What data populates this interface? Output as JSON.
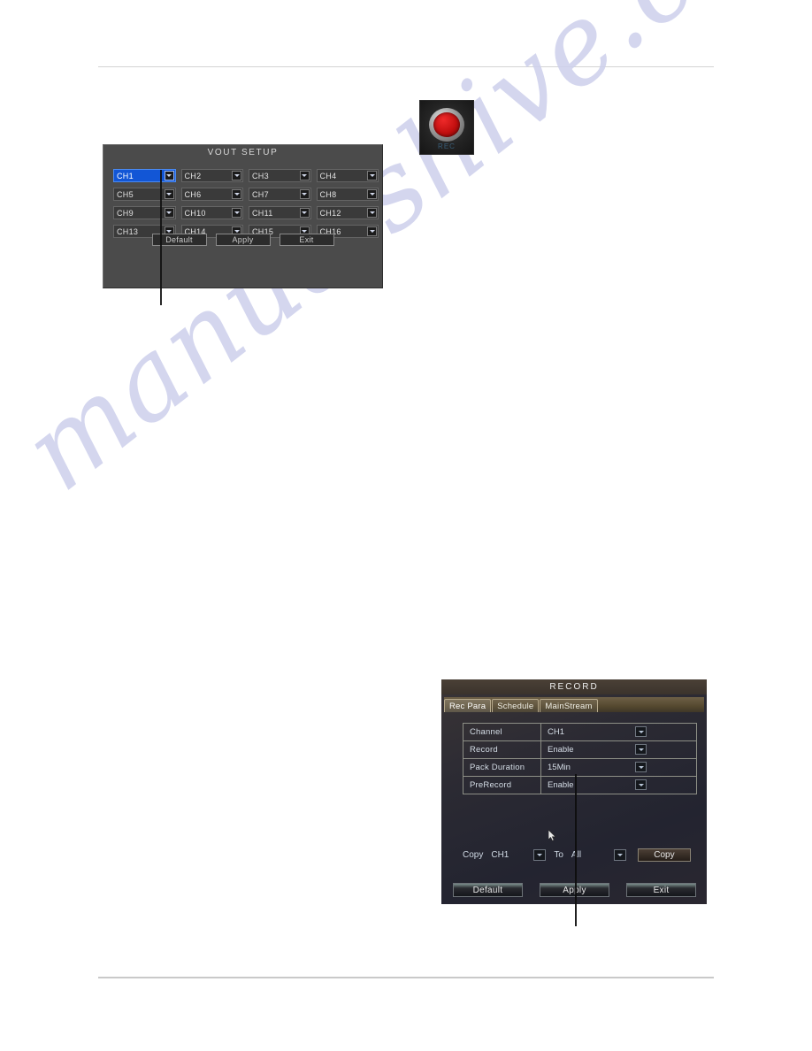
{
  "watermark": {
    "text": "manualshive.com"
  },
  "vout_dialog": {
    "title": "VOUT SETUP",
    "channels": [
      "CH1",
      "CH2",
      "CH3",
      "CH4",
      "CH5",
      "CH6",
      "CH7",
      "CH8",
      "CH9",
      "CH10",
      "CH11",
      "CH12",
      "CH13",
      "CH14",
      "CH15",
      "CH16"
    ],
    "selected_index": 0,
    "buttons": {
      "default": "Default",
      "apply": "Apply",
      "exit": "Exit"
    }
  },
  "record_icon": {
    "label": "REC",
    "button_color": "#c20f0f"
  },
  "record_dialog": {
    "title": "RECORD",
    "tabs": [
      {
        "label": "Rec Para",
        "active": true
      },
      {
        "label": "Schedule",
        "active": false
      },
      {
        "label": "MainStream",
        "active": false
      }
    ],
    "rows": [
      {
        "label": "Channel",
        "value": "CH1"
      },
      {
        "label": "Record",
        "value": "Enable"
      },
      {
        "label": "Pack Duration",
        "value": "15Min"
      },
      {
        "label": "PreRecord",
        "value": "Enable"
      }
    ],
    "copy": {
      "label": "Copy",
      "from": "CH1",
      "to_label": "To",
      "to": "All",
      "button": "Copy"
    },
    "buttons": {
      "default": "Default",
      "apply": "Apply",
      "exit": "Exit"
    }
  }
}
